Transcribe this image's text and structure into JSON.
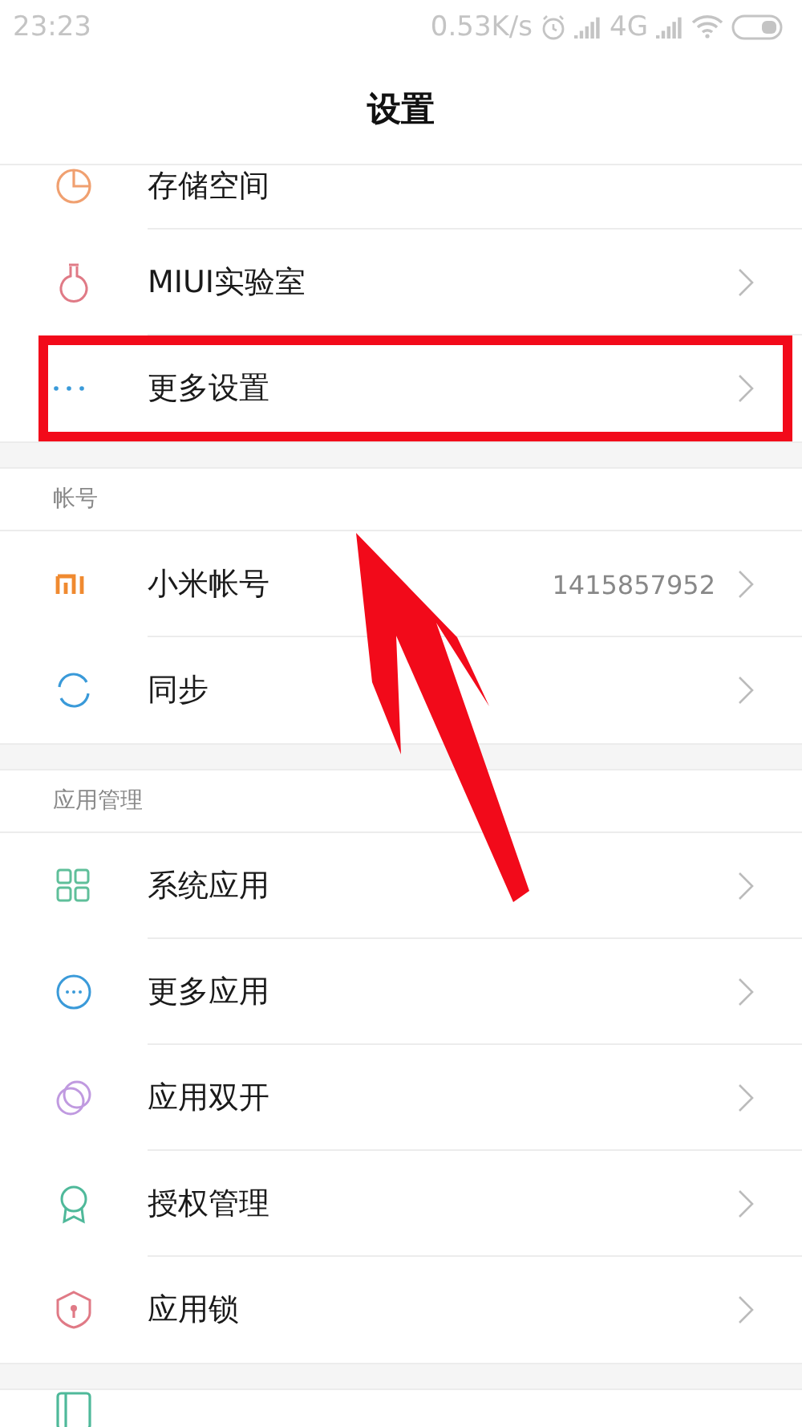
{
  "status_bar": {
    "time": "23:23",
    "speed": "0.53K/s",
    "network": "4G"
  },
  "header": {
    "title": "设置"
  },
  "sections": [
    {
      "items": [
        {
          "kind": "storage",
          "label": "存储空间",
          "highlighted": false
        },
        {
          "kind": "lab",
          "label": "MIUI实验室",
          "highlighted": false
        },
        {
          "kind": "dots",
          "label": "更多设置",
          "highlighted": true
        }
      ]
    },
    {
      "title": "帐号",
      "items": [
        {
          "kind": "mi",
          "label": "小米帐号",
          "value": "1415857952",
          "highlighted": false
        },
        {
          "kind": "sync",
          "label": "同步",
          "highlighted": false
        }
      ]
    },
    {
      "title": "应用管理",
      "items": [
        {
          "kind": "grid",
          "label": "系统应用",
          "highlighted": false
        },
        {
          "kind": "more-circle",
          "label": "更多应用",
          "highlighted": false
        },
        {
          "kind": "dual",
          "label": "应用双开",
          "highlighted": false
        },
        {
          "kind": "ribbon",
          "label": "授权管理",
          "highlighted": false
        },
        {
          "kind": "shield",
          "label": "应用锁",
          "highlighted": false
        }
      ]
    },
    {
      "items": [
        {
          "kind": "book"
        }
      ]
    }
  ]
}
